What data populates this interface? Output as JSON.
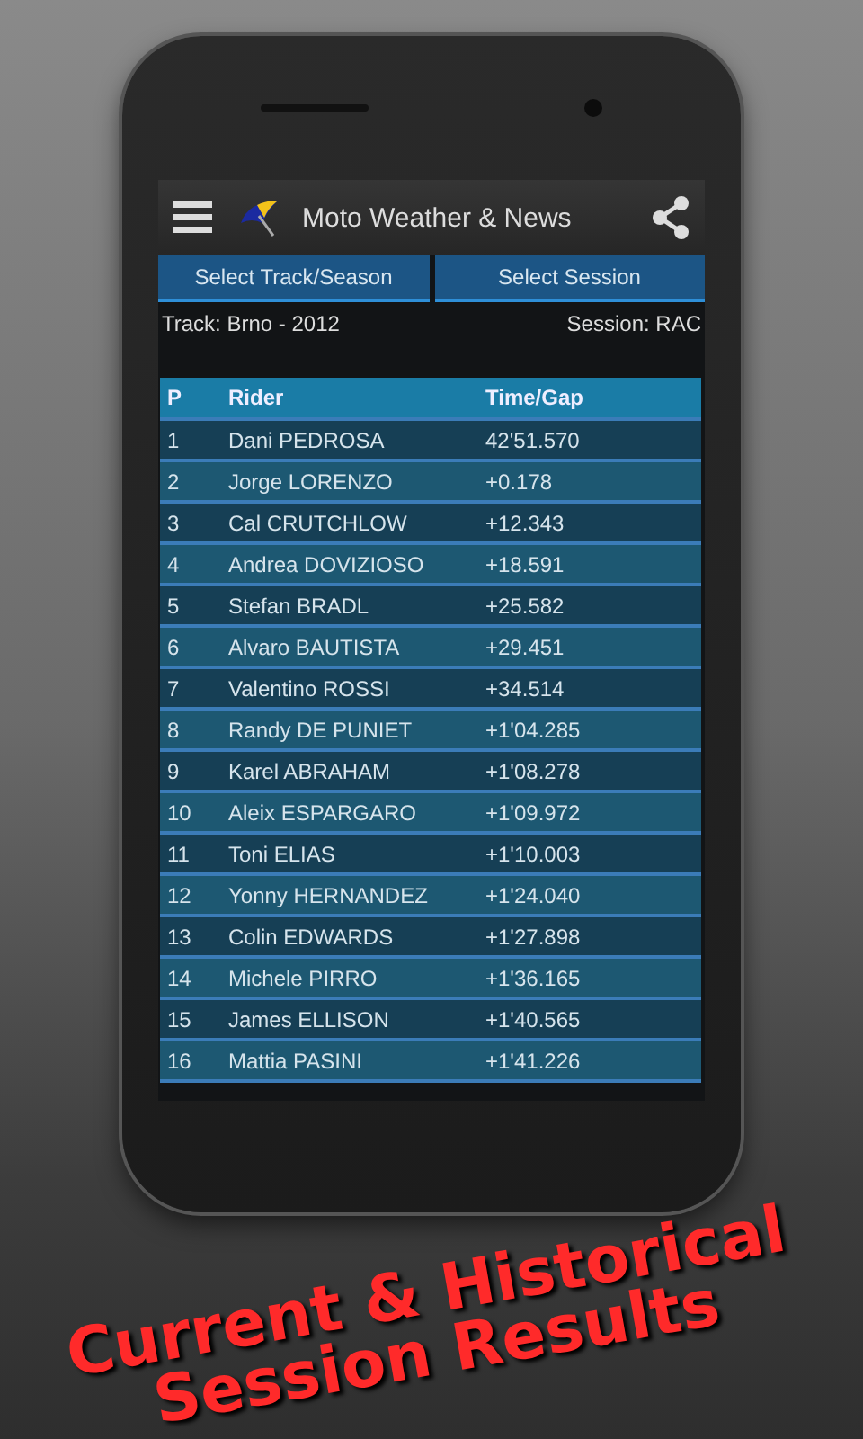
{
  "app_bar": {
    "title": "Moto Weather & News"
  },
  "buttons": [
    "Select Track/Season",
    "Select Session"
  ],
  "track_label": "Track: Brno - 2012",
  "session_label": "Session: RAC",
  "table": {
    "columns": [
      "P",
      "Rider",
      "Time/Gap"
    ],
    "rows": [
      [
        "1",
        "Dani PEDROSA",
        "42'51.570"
      ],
      [
        "2",
        "Jorge LORENZO",
        "+0.178"
      ],
      [
        "3",
        "Cal CRUTCHLOW",
        "+12.343"
      ],
      [
        "4",
        "Andrea DOVIZIOSO",
        "+18.591"
      ],
      [
        "5",
        "Stefan BRADL",
        "+25.582"
      ],
      [
        "6",
        "Alvaro BAUTISTA",
        "+29.451"
      ],
      [
        "7",
        "Valentino ROSSI",
        "+34.514"
      ],
      [
        "8",
        "Randy DE PUNIET",
        "+1'04.285"
      ],
      [
        "9",
        "Karel ABRAHAM",
        "+1'08.278"
      ],
      [
        "10",
        "Aleix ESPARGARO",
        "+1'09.972"
      ],
      [
        "11",
        "Toni ELIAS",
        "+1'10.003"
      ],
      [
        "12",
        "Yonny HERNANDEZ",
        "+1'24.040"
      ],
      [
        "13",
        "Colin EDWARDS",
        "+1'27.898"
      ],
      [
        "14",
        "Michele PIRRO",
        "+1'36.165"
      ],
      [
        "15",
        "James ELLISON",
        "+1'40.565"
      ],
      [
        "16",
        "Mattia PASINI",
        "+1'41.226"
      ]
    ]
  },
  "caption": [
    "Current & Historical",
    "Session Results"
  ]
}
